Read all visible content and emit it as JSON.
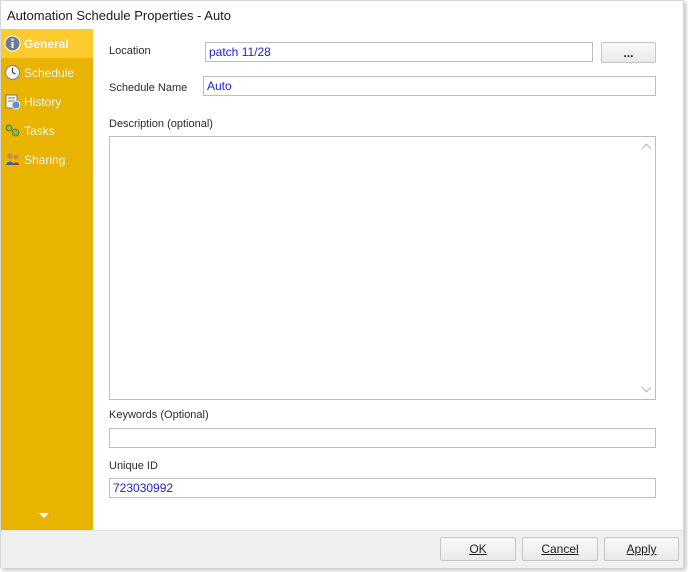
{
  "window": {
    "title": "Automation Schedule Properties - Auto"
  },
  "sidebar": {
    "items": [
      {
        "label": "General",
        "icon": "info-icon"
      },
      {
        "label": "Schedule",
        "icon": "clock-icon"
      },
      {
        "label": "History",
        "icon": "history-icon"
      },
      {
        "label": "Tasks",
        "icon": "tasks-icon"
      },
      {
        "label": "Sharing",
        "icon": "users-icon"
      }
    ],
    "active": "General"
  },
  "form": {
    "location_label": "Location",
    "location_value": "patch 11/28",
    "browse_label": "...",
    "schedule_name_label": "Schedule Name",
    "schedule_name_value": "Auto",
    "description_label": "Description (optional)",
    "description_value": "",
    "keywords_label": "Keywords (Optional)",
    "keywords_value": "",
    "unique_id_label": "Unique ID",
    "unique_id_value": "723030992"
  },
  "footer": {
    "ok_label": "OK",
    "cancel_label": "Cancel",
    "apply_label": "Apply"
  },
  "colors": {
    "sidebar": "#e8b400",
    "sidebar_active": "#ffcb2e",
    "input_text": "#2222cc"
  }
}
